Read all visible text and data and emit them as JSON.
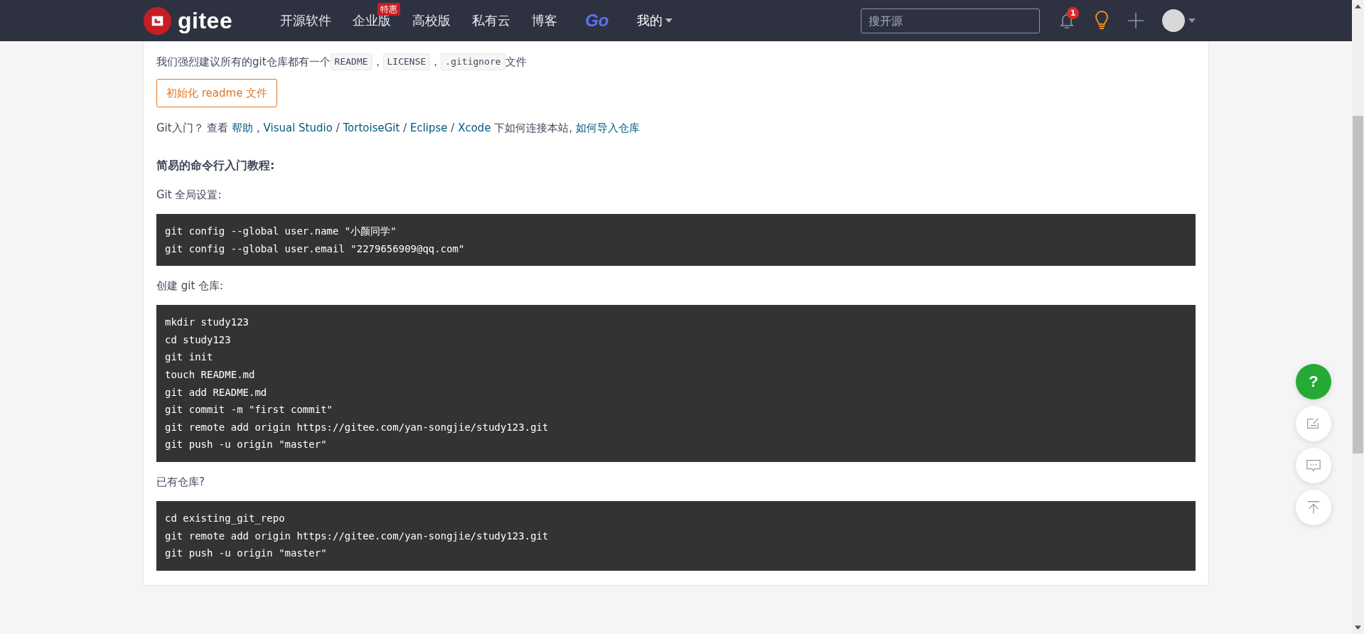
{
  "header": {
    "logo": "gitee",
    "nav": [
      {
        "label": "开源软件",
        "kind": "plain"
      },
      {
        "label": "企业版",
        "kind": "plain",
        "badge": "特惠"
      },
      {
        "label": "高校版",
        "kind": "plain"
      },
      {
        "label": "私有云",
        "kind": "plain"
      },
      {
        "label": "博客",
        "kind": "plain"
      },
      {
        "label": "Go",
        "kind": "brand"
      },
      {
        "label": "我的",
        "kind": "dropdown"
      }
    ],
    "search": {
      "placeholder": "搜开源"
    },
    "notification_count": "1"
  },
  "content": {
    "recommendation": [
      {
        "kind": "text",
        "text": "我们强烈建议所有的git仓库都有一个"
      },
      {
        "kind": "code",
        "text": "README"
      },
      {
        "kind": "text",
        "text": "，"
      },
      {
        "kind": "code",
        "text": "LICENSE"
      },
      {
        "kind": "text",
        "text": "，"
      },
      {
        "kind": "code",
        "text": ".gitignore"
      },
      {
        "kind": "text",
        "text": "文件"
      }
    ],
    "init_button": "初始化 readme 文件",
    "intro": [
      {
        "kind": "text",
        "text": "Git入门？ 查看 "
      },
      {
        "kind": "link",
        "text": "帮助"
      },
      {
        "kind": "text",
        "text": " , "
      },
      {
        "kind": "link",
        "text": "Visual Studio"
      },
      {
        "kind": "text",
        "text": " / "
      },
      {
        "kind": "link",
        "text": "TortoiseGit"
      },
      {
        "kind": "text",
        "text": " / "
      },
      {
        "kind": "link",
        "text": "Eclipse"
      },
      {
        "kind": "text",
        "text": " / "
      },
      {
        "kind": "link",
        "text": "Xcode"
      },
      {
        "kind": "text",
        "text": " 下如何连接本站, "
      },
      {
        "kind": "link",
        "text": "如何导入仓库"
      }
    ],
    "tutorial_heading": "简易的命令行入门教程:",
    "sections": [
      {
        "label": "Git 全局设置:",
        "code": [
          "git config --global user.name \"小颜同学\"",
          "git config --global user.email \"2279656909@qq.com\""
        ]
      },
      {
        "label": "创建 git 仓库:",
        "code": [
          "mkdir study123",
          "cd study123",
          "git init",
          "touch README.md",
          "git add README.md",
          "git commit -m \"first commit\"",
          "git remote add origin https://gitee.com/yan-songjie/study123.git",
          "git push -u origin \"master\""
        ]
      },
      {
        "label": "已有仓库?",
        "code": [
          "cd existing_git_repo",
          "git remote add origin https://gitee.com/yan-songjie/study123.git",
          "git push -u origin \"master\""
        ]
      }
    ]
  },
  "float_buttons": [
    {
      "kind": "help",
      "label": "?"
    },
    {
      "kind": "edit"
    },
    {
      "kind": "comment"
    },
    {
      "kind": "top"
    }
  ]
}
